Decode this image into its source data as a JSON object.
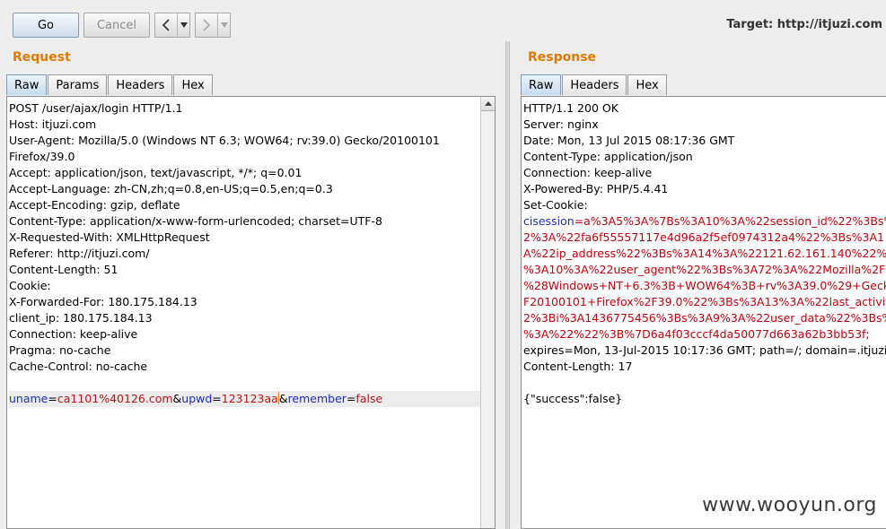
{
  "toolbar": {
    "go_label": "Go",
    "cancel_label": "Cancel",
    "back_icon": "chevron-left",
    "forward_icon": "chevron-right",
    "dropdown_icon": "triangle-down",
    "target_label": "Target: http://itjuzi.com"
  },
  "request": {
    "title": "Request",
    "tabs": [
      "Raw",
      "Params",
      "Headers",
      "Hex"
    ],
    "active_tab": "Raw",
    "lines": [
      "POST /user/ajax/login HTTP/1.1",
      "Host: itjuzi.com",
      "User-Agent: Mozilla/5.0 (Windows NT 6.3; WOW64; rv:39.0) Gecko/20100101",
      "Firefox/39.0",
      "Accept: application/json, text/javascript, */*; q=0.01",
      "Accept-Language: zh-CN,zh;q=0.8,en-US;q=0.5,en;q=0.3",
      "Accept-Encoding: gzip, deflate",
      "Content-Type: application/x-www-form-urlencoded; charset=UTF-8",
      "X-Requested-With: XMLHttpRequest",
      "Referer: http://itjuzi.com/",
      "Content-Length: 51",
      "Cookie:",
      "X-Forwarded-For: 180.175.184.13",
      "client_ip: 180.175.184.13",
      "Connection: keep-alive",
      "Pragma: no-cache",
      "Cache-Control: no-cache",
      ""
    ],
    "body": {
      "k1": "uname",
      "v1": "ca1101%40126.com",
      "k2": "upwd",
      "v2": "123123aa",
      "k3": "remember",
      "v3": "false"
    }
  },
  "response": {
    "title": "Response",
    "tabs": [
      "Raw",
      "Headers",
      "Hex"
    ],
    "active_tab": "Raw",
    "lines_top": [
      "HTTP/1.1 200 OK",
      "Server: nginx",
      "Date: Mon, 13 Jul 2015 08:17:36 GMT",
      "Content-Type: application/json",
      "Connection: keep-alive",
      "X-Powered-By: PHP/5.4.41",
      "Set-Cookie:"
    ],
    "cookie_key": "cisession",
    "cookie_lines": [
      "=a%3A5%3A%7Bs%3A10%3A%22session_id%22%3Bs%",
      "2%3A%22fa6f55557117e4d96a2f5ef0974312a4%22%3Bs%3A1",
      "A%22ip_address%22%3Bs%3A14%3A%22121.62.161.140%22%",
      "%3A10%3A%22user_agent%22%3Bs%3A72%3A%22Mozilla%2F",
      "%28Windows+NT+6.3%3B+WOW64%3B+rv%3A39.0%29+Geck",
      "F20100101+Firefox%2F39.0%22%3Bs%3A13%3A%22last_activit",
      "2%3Bi%3A1436775456%3Bs%3A9%3A%22user_data%22%3Bs%",
      "%3A%22%22%3B%7D6a4f03cccf4da50077d663a62b3bb53f;"
    ],
    "lines_bottom": [
      "expires=Mon, 13-Jul-2015 10:17:36 GMT; path=/; domain=.itjuzi",
      "Content-Length: 17",
      "",
      "{\"success\":false}"
    ]
  },
  "watermark": "www.wooyun.org"
}
